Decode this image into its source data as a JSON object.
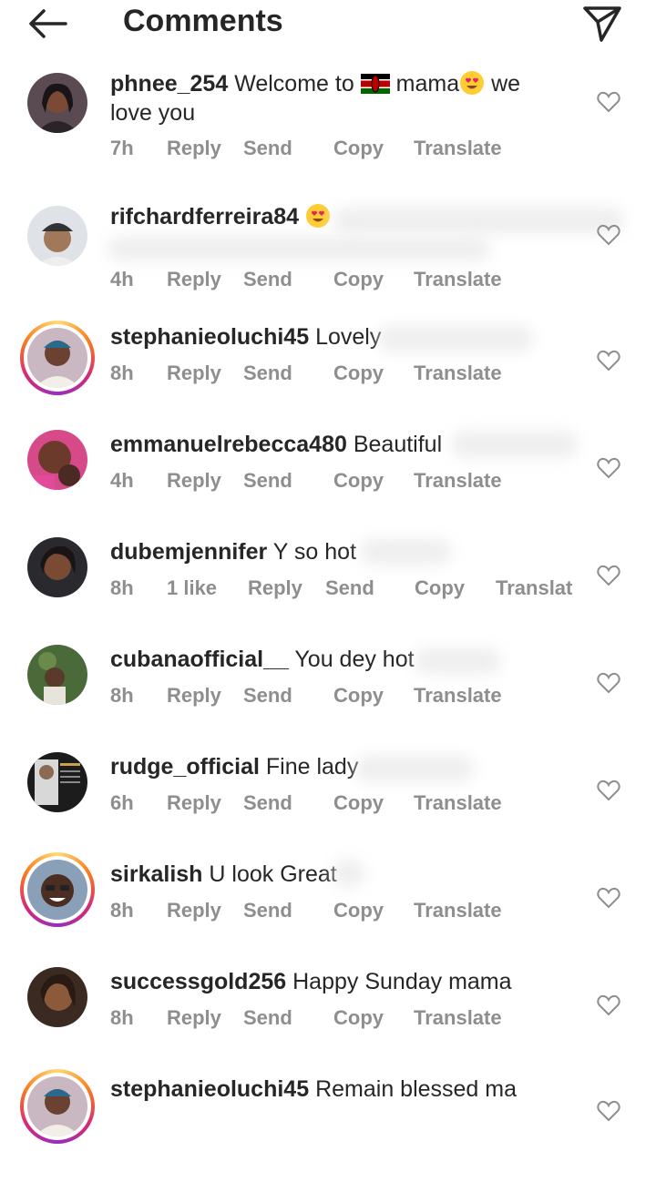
{
  "header": {
    "title": "Comments",
    "back_icon": "arrow-left-icon",
    "share_icon": "paper-plane-icon"
  },
  "comments": [
    {
      "username": "phnee_254",
      "text_a": "Welcome to",
      "text_b": "mama",
      "text_c": "we love you",
      "time": "7h",
      "reply": "Reply",
      "send": "Send",
      "copy": "Copy",
      "translate": "Translate"
    },
    {
      "username": "rifchardferreira84",
      "text": "",
      "time": "4h",
      "reply": "Reply",
      "send": "Send",
      "copy": "Copy",
      "translate": "Translate"
    },
    {
      "username": "stephanieoluchi45",
      "text": "Lovely",
      "time": "8h",
      "reply": "Reply",
      "send": "Send",
      "copy": "Copy",
      "translate": "Translate"
    },
    {
      "username": "emmanuelrebecca480",
      "text": "Beautiful",
      "time": "4h",
      "reply": "Reply",
      "send": "Send",
      "copy": "Copy",
      "translate": "Translate"
    },
    {
      "username": "dubemjennifer",
      "text": "Y so hot",
      "time": "8h",
      "likes": "1 like",
      "reply": "Reply",
      "send": "Send",
      "copy": "Copy",
      "translate": "Translat"
    },
    {
      "username": "cubanaofficial__",
      "text": "You dey hot",
      "time": "8h",
      "reply": "Reply",
      "send": "Send",
      "copy": "Copy",
      "translate": "Translate"
    },
    {
      "username": "rudge_official",
      "text": "Fine lady",
      "time": "6h",
      "reply": "Reply",
      "send": "Send",
      "copy": "Copy",
      "translate": "Translate"
    },
    {
      "username": "sirkalish",
      "text": "U look Great",
      "time": "8h",
      "reply": "Reply",
      "send": "Send",
      "copy": "Copy",
      "translate": "Translate"
    },
    {
      "username": "successgold256",
      "text": "Happy Sunday mama",
      "time": "8h",
      "reply": "Reply",
      "send": "Send",
      "copy": "Copy",
      "translate": "Translate"
    },
    {
      "username": "stephanieoluchi45",
      "text": "Remain blessed ma"
    }
  ],
  "colors": {
    "text": "#262626",
    "meta": "#8e8e8e",
    "story_ring": "#d62976"
  }
}
